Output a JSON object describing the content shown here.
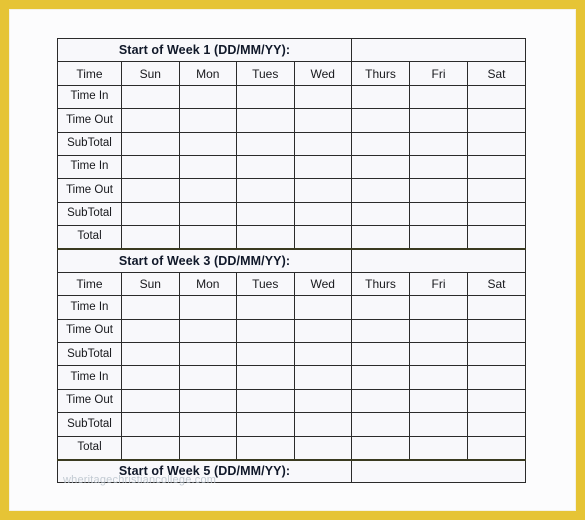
{
  "document": {
    "type": "timesheet-template",
    "frame_color": "#e6c435",
    "page_background": "#fcfcfd"
  },
  "palette": {
    "week_header_blue": "#9ccbef",
    "total_row_yellow": "#ffffc0",
    "cell_background": "#f8f8fb",
    "label_background": "#ffffff",
    "grid_line": "#2b2b2b",
    "text": "#17181c"
  },
  "columns": {
    "headers": [
      "Time",
      "Sun",
      "Mon",
      "Tues",
      "Wed",
      "Thurs",
      "Fri",
      "Sat"
    ],
    "label_header": "Time",
    "days": [
      "Sun",
      "Mon",
      "Tues",
      "Wed",
      "Thurs",
      "Fri",
      "Sat"
    ]
  },
  "row_labels": [
    "Time In",
    "Time Out",
    "SubTotal",
    "Time In",
    "Time Out",
    "SubTotal"
  ],
  "total_label": "Total",
  "weeks": [
    {
      "title": "Start of Week 1 (DD/MM/YY):",
      "date_value": "",
      "rows": [
        {
          "label": "Time In",
          "values": [
            "",
            "",
            "",
            "",
            "",
            "",
            ""
          ]
        },
        {
          "label": "Time Out",
          "values": [
            "",
            "",
            "",
            "",
            "",
            "",
            ""
          ]
        },
        {
          "label": "SubTotal",
          "values": [
            "",
            "",
            "",
            "",
            "",
            "",
            ""
          ]
        },
        {
          "label": "Time In",
          "values": [
            "",
            "",
            "",
            "",
            "",
            "",
            ""
          ]
        },
        {
          "label": "Time Out",
          "values": [
            "",
            "",
            "",
            "",
            "",
            "",
            ""
          ]
        },
        {
          "label": "SubTotal",
          "values": [
            "",
            "",
            "",
            "",
            "",
            "",
            ""
          ]
        }
      ],
      "total": {
        "label": "Total",
        "values": [
          "",
          "",
          "",
          "",
          "",
          "",
          ""
        ]
      }
    },
    {
      "title": "Start of Week 3 (DD/MM/YY):",
      "date_value": "",
      "rows": [
        {
          "label": "Time In",
          "values": [
            "",
            "",
            "",
            "",
            "",
            "",
            ""
          ]
        },
        {
          "label": "Time Out",
          "values": [
            "",
            "",
            "",
            "",
            "",
            "",
            ""
          ]
        },
        {
          "label": "SubTotal",
          "values": [
            "",
            "",
            "",
            "",
            "",
            "",
            ""
          ]
        },
        {
          "label": "Time In",
          "values": [
            "",
            "",
            "",
            "",
            "",
            "",
            ""
          ]
        },
        {
          "label": "Time Out",
          "values": [
            "",
            "",
            "",
            "",
            "",
            "",
            ""
          ]
        },
        {
          "label": "SubTotal",
          "values": [
            "",
            "",
            "",
            "",
            "",
            "",
            ""
          ]
        }
      ],
      "total": {
        "label": "Total",
        "values": [
          "",
          "",
          "",
          "",
          "",
          "",
          ""
        ]
      }
    },
    {
      "title": "Start of Week 5 (DD/MM/YY):",
      "date_value": "",
      "rows": [],
      "total": null,
      "truncated": true
    }
  ],
  "watermark": "wheritagechristiancollege.com"
}
